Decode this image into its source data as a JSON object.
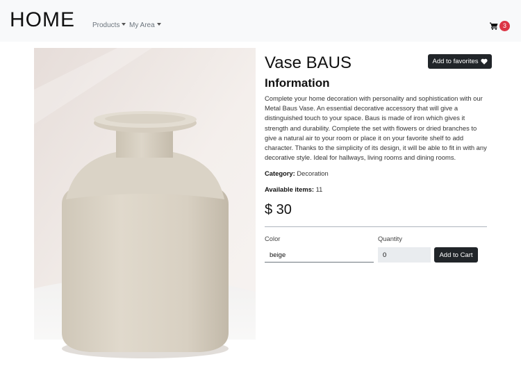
{
  "navbar": {
    "brand": "HOME",
    "menu": [
      {
        "label": "Products"
      },
      {
        "label": "My Area"
      }
    ],
    "cart": {
      "icon": "shopping-cart-icon",
      "count": "3",
      "badge_color": "#dc3545"
    }
  },
  "product": {
    "name": "Vase BAUS",
    "favorite_button": {
      "label": "Add to favorites",
      "icon": "heart-icon"
    },
    "info_heading": "Information",
    "description": "Complete your home decoration with personality and sophistication with our Metal Baus Vase. An essential decorative accessory that will give a distinguished touch to your space. Baus is made of iron which gives it strength and durability. Complete the set with flowers or dried branches to give a natural air to your room or place it on your favorite shelf to add character. Thanks to the simplicity of its design, it will be able to fit in with any decorative style. Ideal for hallways, living rooms and dining rooms.",
    "category": {
      "label": "Category:",
      "value": "Decoration"
    },
    "available": {
      "label": "Available items:",
      "value": "11"
    },
    "price": "$ 30",
    "image": {
      "subject": "beige ceramic vase",
      "background_color": "#f1ece8",
      "vase_color": "#ddd6c8"
    }
  },
  "form": {
    "color": {
      "label": "Color",
      "value": "beige"
    },
    "quantity": {
      "label": "Quantity",
      "value": "0"
    },
    "add_to_cart_label": "Add to Cart"
  },
  "theme": {
    "dark_button": "#212529",
    "navbar_bg": "#f8f9fa"
  }
}
